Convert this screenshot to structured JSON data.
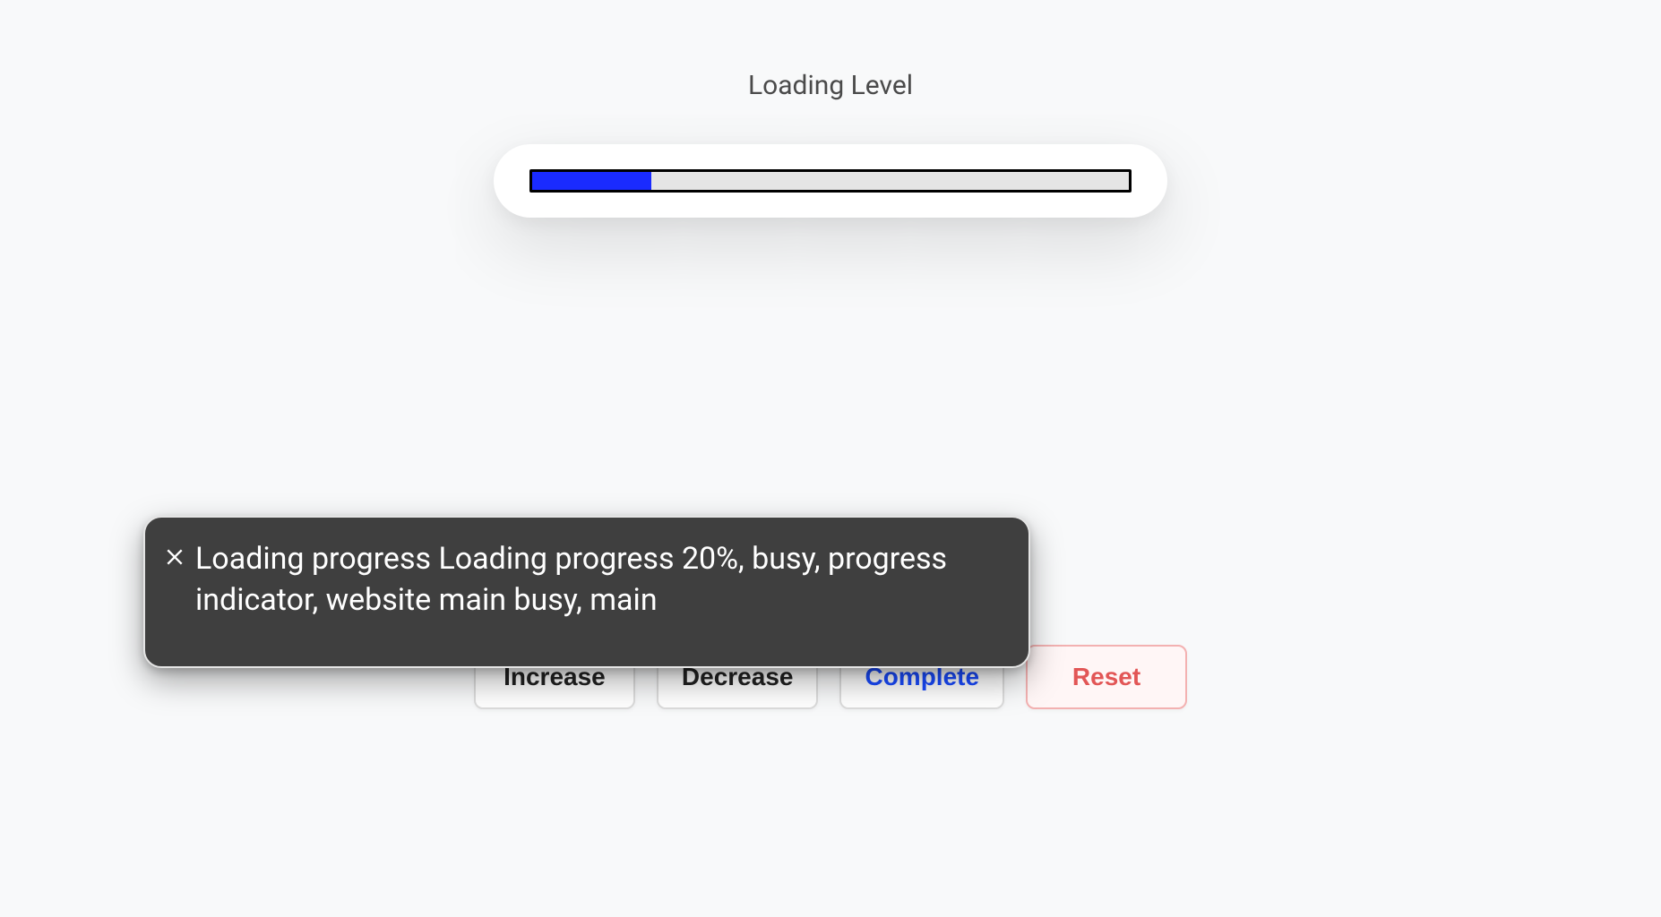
{
  "title": "Loading Level",
  "progress": {
    "percent": 20
  },
  "buttons": {
    "increase": "Increase",
    "decrease": "Decrease",
    "complete": "Complete",
    "reset": "Reset"
  },
  "tooltip": {
    "text": "Loading progress Loading progress 20%, busy, progress indicator, website main busy, main"
  }
}
